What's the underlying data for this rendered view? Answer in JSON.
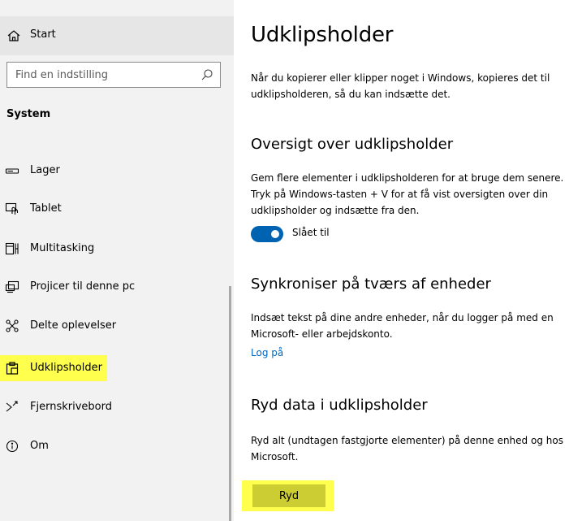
{
  "sidebar": {
    "start_label": "Start",
    "search_placeholder": "Find en indstilling",
    "section_title": "System",
    "items": [
      {
        "label": "Lager",
        "icon": "storage-icon"
      },
      {
        "label": "Tablet",
        "icon": "tablet-icon"
      },
      {
        "label": "Multitasking",
        "icon": "multitasking-icon"
      },
      {
        "label": "Projicer til denne pc",
        "icon": "project-icon"
      },
      {
        "label": "Delte oplevelser",
        "icon": "shared-experiences-icon"
      },
      {
        "label": "Udklipsholder",
        "icon": "clipboard-icon",
        "selected": true
      },
      {
        "label": "Fjernskrivebord",
        "icon": "remote-desktop-icon"
      },
      {
        "label": "Om",
        "icon": "info-icon"
      }
    ]
  },
  "main": {
    "title": "Udklipsholder",
    "intro": "Når du kopierer eller klipper noget i Windows, kopieres det til udklipsholderen, så du kan indsætte det.",
    "history": {
      "heading": "Oversigt over udklipsholder",
      "description": "Gem flere elementer i udklipsholderen for at bruge dem senere. Tryk på Windows-tasten + V for at få vist oversigten over din udklipsholder og indsætte fra den.",
      "toggle_label": "Slået til",
      "toggle_on": true
    },
    "sync": {
      "heading": "Synkroniser på tværs af enheder",
      "description": "Indsæt tekst på dine andre enheder, når du logger på med en Microsoft- eller arbejdskonto.",
      "link": "Log på"
    },
    "clear": {
      "heading": "Ryd data i udklipsholder",
      "description": "Ryd alt (undtagen fastgjorte elementer) på denne enhed og hos Microsoft.",
      "button": "Ryd"
    }
  },
  "colors": {
    "accent": "#0063b1",
    "link": "#0067c0",
    "highlight": "#ffff4d",
    "sidebar_bg": "#f2f2f2"
  }
}
